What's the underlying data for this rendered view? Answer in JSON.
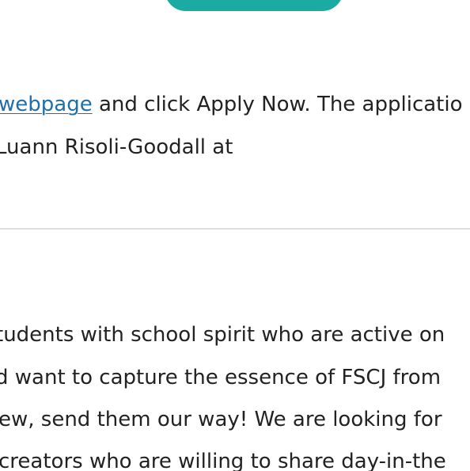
{
  "application_section": {
    "link_text": "webpage",
    "line1_rest": " and click Apply Now. The applicatio",
    "line2": "Luann Risoli-Goodall at"
  },
  "creator_section": {
    "lines": [
      "tudents with school spirit who are active on",
      "d want to capture the essence of FSCJ from",
      "ew, send them our way! We are looking for",
      "creators who are willing to share day-in-the"
    ]
  },
  "colors": {
    "button": "#1aaba3",
    "link": "#1f6fa8",
    "text": "#222222",
    "divider": "#dedede"
  }
}
